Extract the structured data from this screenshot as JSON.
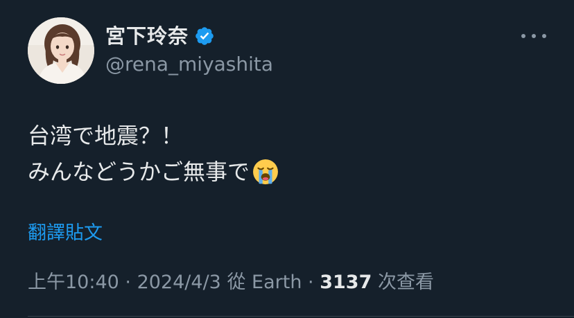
{
  "author": {
    "display_name": "宮下玲奈",
    "handle": "@rena_miyashita",
    "verified": true
  },
  "tweet": {
    "lines": [
      "台湾で地震？！",
      "みんなどうかご無事で"
    ],
    "emoji": "loudly-crying-face"
  },
  "translate_label": "翻譯貼文",
  "meta": {
    "time": "上午10:40",
    "separator": "·",
    "date": "2024/4/3",
    "source_prefix": "從",
    "source": "Earth",
    "views_count": "3137",
    "views_label": "次查看"
  },
  "colors": {
    "background": "#15202b",
    "text": "#e7e9ea",
    "muted": "#8b98a5",
    "accent": "#1d9bf0"
  }
}
